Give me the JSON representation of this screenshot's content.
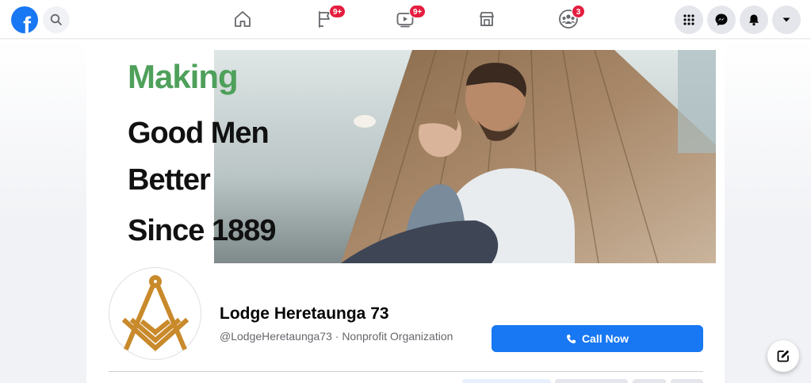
{
  "topbar": {
    "logo_letter": "f",
    "icons": {
      "search": "search-icon",
      "home": "home-icon",
      "pages": "flag-icon",
      "watch": "video-icon",
      "marketplace": "store-icon",
      "groups": "groups-icon",
      "menu": "grid-menu-icon",
      "messenger": "messenger-icon",
      "notifications": "bell-icon",
      "account": "caret-down-icon"
    },
    "badges": {
      "pages": "9+",
      "watch": "9+",
      "groups": "3"
    }
  },
  "cover": {
    "line1": "Making",
    "line2": "Good Men",
    "line3": "Better",
    "line4": "Since 1889",
    "accent_color": "#4ea05a"
  },
  "page": {
    "name": "Lodge Heretaunga 73",
    "subtitle": "@LodgeHeretaunga73 · Nonprofit Organization",
    "avatar_icon": "square-and-compass-icon",
    "avatar_color": "#c98a2b"
  },
  "actions": {
    "call_now": "Call Now",
    "call_icon": "phone-icon",
    "compose_icon": "compose-icon"
  },
  "colors": {
    "brand": "#1877f2",
    "badge": "#e41e3f"
  }
}
